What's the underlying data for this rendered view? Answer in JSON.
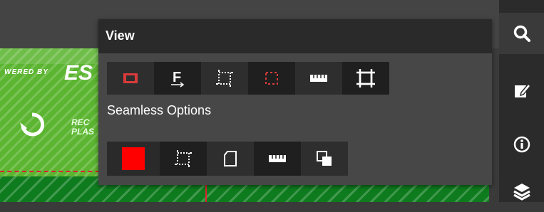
{
  "panel": {
    "title": "View",
    "view_tools": [
      {
        "name": "bleed-view-tool",
        "icon": "red-bleed-rect-icon"
      },
      {
        "name": "font-view-tool",
        "icon": "font-underline-icon"
      },
      {
        "name": "trim-guides-tool",
        "icon": "dotted-frame-icon"
      },
      {
        "name": "safe-area-tool",
        "icon": "red-dotted-frame-icon"
      },
      {
        "name": "ruler-tool",
        "icon": "ruler-icon"
      },
      {
        "name": "crop-marks-tool",
        "icon": "crop-icon"
      }
    ],
    "seamless_label": "Seamless Options",
    "seamless_tools": [
      {
        "name": "seamless-color-tool",
        "icon": "red-square-icon",
        "color": "#ff0000"
      },
      {
        "name": "seamless-guides-tool",
        "icon": "dotted-frame-icon"
      },
      {
        "name": "page-tool",
        "icon": "page-icon"
      },
      {
        "name": "seamless-ruler-tool",
        "icon": "ruler-icon"
      },
      {
        "name": "overlap-tool",
        "icon": "overlap-squares-icon"
      }
    ]
  },
  "sidebar": {
    "buttons": [
      {
        "name": "search",
        "icon": "search-icon",
        "active": true
      },
      {
        "name": "edit",
        "icon": "edit-note-icon"
      },
      {
        "name": "info",
        "icon": "info-icon"
      },
      {
        "name": "layers",
        "icon": "layers-icon"
      }
    ]
  },
  "canvas": {
    "banner_line1": "WERED BY",
    "banner_logo": "ES",
    "banner_line2": "REC PLAS"
  },
  "colors": {
    "accent_red": "#ff0000",
    "banner_green": "#5cb531",
    "floor_green": "#0e7c1e",
    "panel_bg": "#474747",
    "panel_header": "#2a2a2a"
  }
}
